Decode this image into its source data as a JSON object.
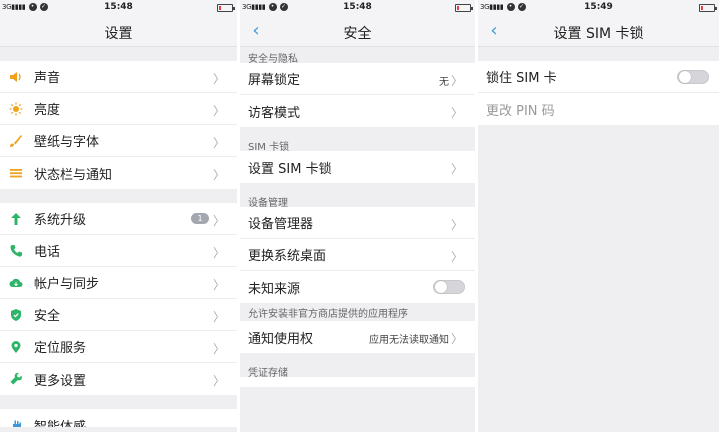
{
  "colors": {
    "accent": "#3a9ad8",
    "sound_icon": "#f0a11e",
    "brightness_icon": "#f0a11e",
    "wallpaper_icon": "#f0a11e",
    "statusbar_icon": "#f0a11e",
    "upgrade_icon": "#2eb56a",
    "phone_icon": "#2eb56a",
    "account_icon": "#2eb56a",
    "security_icon": "#2eb56a",
    "location_icon": "#2eb56a",
    "more_icon": "#2eb56a",
    "smart_icon": "#3a9ad8"
  },
  "screens": {
    "settings": {
      "status": {
        "network": "3G",
        "time": "15:48"
      },
      "title": "设置",
      "group1": [
        {
          "label": "声音",
          "icon": "speaker-icon"
        },
        {
          "label": "亮度",
          "icon": "sun-icon"
        },
        {
          "label": "壁纸与字体",
          "icon": "brush-icon"
        },
        {
          "label": "状态栏与通知",
          "icon": "list-icon"
        }
      ],
      "group2": [
        {
          "label": "系统升级",
          "icon": "arrow-up-icon",
          "badge": "1"
        },
        {
          "label": "电话",
          "icon": "phone-icon"
        },
        {
          "label": "帐户与同步",
          "icon": "cloud-sync-icon"
        },
        {
          "label": "安全",
          "icon": "shield-icon"
        },
        {
          "label": "定位服务",
          "icon": "location-pin-icon"
        },
        {
          "label": "更多设置",
          "icon": "wrench-icon"
        }
      ],
      "group3": [
        {
          "label": "智能体感",
          "icon": "hand-gesture-icon"
        }
      ]
    },
    "security": {
      "status": {
        "network": "3G",
        "time": "15:48"
      },
      "title": "安全",
      "section1": {
        "header": "安全与隐私",
        "rows": [
          {
            "label": "屏幕锁定",
            "value": "无"
          },
          {
            "label": "访客模式"
          }
        ]
      },
      "section2": {
        "header": "SIM 卡锁",
        "rows": [
          {
            "label": "设置 SIM 卡锁"
          }
        ]
      },
      "section3": {
        "header": "设备管理",
        "rows": [
          {
            "label": "设备管理器"
          },
          {
            "label": "更换系统桌面"
          },
          {
            "label": "未知来源",
            "toggle": "off"
          }
        ]
      },
      "section4": {
        "header": "允许安装非官方商店提供的应用程序",
        "rows": [
          {
            "label": "通知使用权",
            "value": "应用无法读取通知"
          }
        ]
      },
      "section5": {
        "header": "凭证存储"
      }
    },
    "sim_lock": {
      "status": {
        "network": "3G",
        "time": "15:49"
      },
      "title": "设置 SIM 卡锁",
      "rows": [
        {
          "label": "锁住 SIM 卡",
          "toggle": "off"
        },
        {
          "label": "更改 PIN 码",
          "disabled": true
        }
      ]
    }
  }
}
